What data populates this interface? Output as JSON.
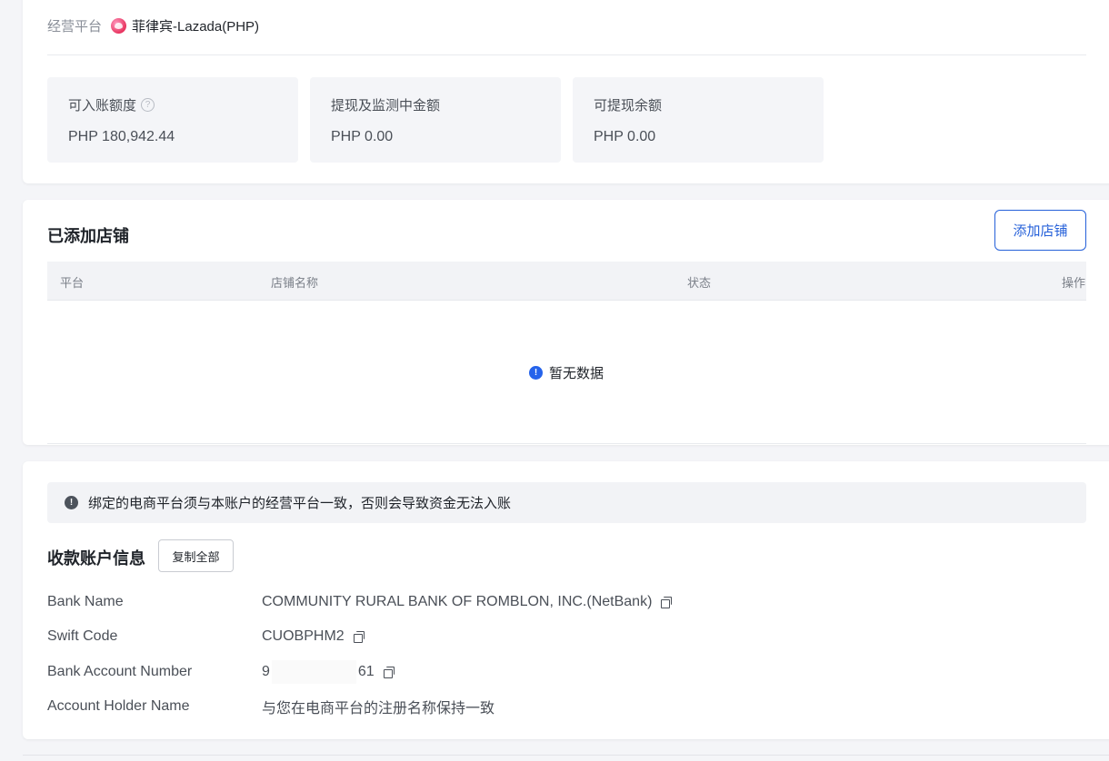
{
  "platform": {
    "label": "经营平台",
    "name": "菲律宾-Lazada(PHP)",
    "icon": "lazada-logo-icon"
  },
  "stats": [
    {
      "label": "可入账额度",
      "value": "PHP 180,942.44",
      "has_help": true
    },
    {
      "label": "提现及监测中金额",
      "value": "PHP 0.00"
    },
    {
      "label": "可提现余额",
      "value": "PHP 0.00"
    }
  ],
  "stores": {
    "title": "已添加店铺",
    "add_button": "添加店铺",
    "columns": [
      "平台",
      "店铺名称",
      "状态",
      "操作"
    ],
    "empty_text": "暂无数据"
  },
  "notice": {
    "text": "绑定的电商平台须与本账户的经营平台一致，否则会导致资金无法入账"
  },
  "account": {
    "title": "收款账户信息",
    "copy_all": "复制全部",
    "fields": [
      {
        "key": "Bank Name",
        "value": "COMMUNITY RURAL BANK OF ROMBLON, INC.(NetBank)"
      },
      {
        "key": "Swift Code",
        "value": "CUOBPHM2"
      },
      {
        "key": "Bank Account Number",
        "value_start": "9",
        "value_end": "61"
      },
      {
        "key": "Account Holder Name",
        "value": "与您在电商平台的注册名称保持一致"
      }
    ]
  },
  "colors": {
    "primary": "#2560d9",
    "info": "#2563eb",
    "background": "#f4f5f8"
  }
}
